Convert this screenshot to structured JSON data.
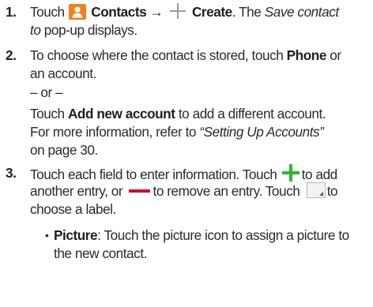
{
  "steps": [
    {
      "number": "1.",
      "touch": "Touch",
      "contacts_label": "Contacts",
      "arrow": "→",
      "create_label": "Create",
      "period": ".",
      "the": "The",
      "popup_title_1": "Save contact",
      "popup_title_2": "to",
      "popup_suffix": "pop-up displays."
    },
    {
      "number": "2.",
      "line1_pre": "To choose where the contact is stored, touch",
      "phone_label": "Phone",
      "line1_post": "or",
      "line2": "an account.",
      "or_line": "– or –",
      "touch": "Touch",
      "add_account_label": "Add new account",
      "add_account_post": "to add a different account.",
      "more_info": "For more information, refer to",
      "ref_title": "“Setting Up Accounts”",
      "page_ref": "on page 30."
    },
    {
      "number": "3.",
      "line1_pre": "Touch each field to enter information. Touch",
      "line1_post": "to add",
      "line2_pre": "another entry, or",
      "line2_mid": "to remove an entry. Touch",
      "line2_post": "to",
      "line3": "choose a label.",
      "bullet_char": "•",
      "bullet_label": "Picture",
      "bullet_line1": ": Touch the picture icon to assign a picture to",
      "bullet_line2": "the new contact."
    }
  ],
  "icons": {
    "contacts": "contacts-icon",
    "create_plus": "plus-gray-icon",
    "add": "plus-green-icon",
    "remove": "minus-red-icon",
    "label_picker": "label-dropdown-icon"
  },
  "colors": {
    "contacts_icon": "#f2811d",
    "plus_gray": "#9a9a9a",
    "plus_green": "#2eb82e",
    "minus_red": "#c8102e",
    "text": "#2b2b2b"
  }
}
